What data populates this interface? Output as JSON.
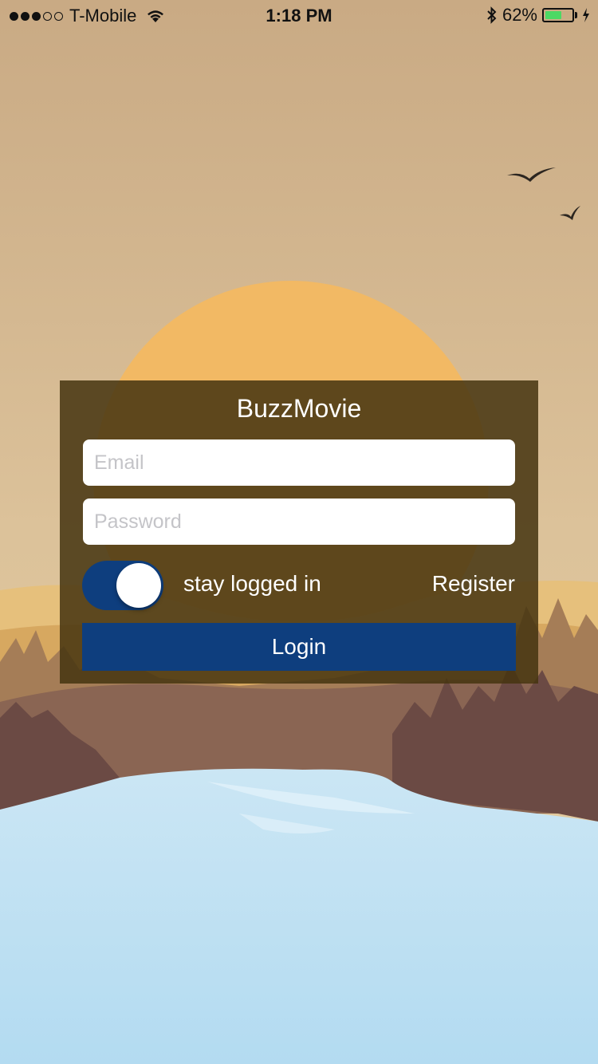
{
  "status_bar": {
    "signal_strength": 3,
    "signal_max": 5,
    "carrier": "T-Mobile",
    "time": "1:18 PM",
    "battery_percent": "62%",
    "battery_level": 0.62,
    "wifi_icon": "wifi-icon",
    "bluetooth_icon": "bluetooth-icon",
    "charging_icon": "charging-bolt-icon"
  },
  "login": {
    "title": "BuzzMovie",
    "email_placeholder": "Email",
    "email_value": "",
    "password_placeholder": "Password",
    "password_value": "",
    "stay_logged_in_label": "stay logged in",
    "stay_logged_in_on": true,
    "register_label": "Register",
    "login_button_label": "Login"
  },
  "colors": {
    "accent": "#0e3e7e",
    "card_background": "#4b3713",
    "battery_green": "#4cd964"
  }
}
